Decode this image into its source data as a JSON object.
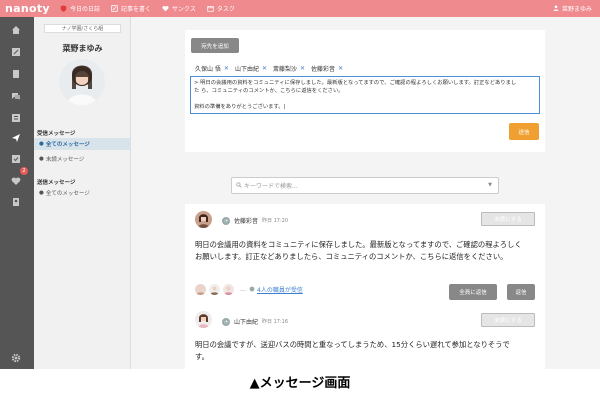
{
  "app": {
    "logo": "nanoty"
  },
  "topnav": [
    {
      "label": "今日の日誌",
      "icon": "shield-icon"
    },
    {
      "label": "記事を書く",
      "icon": "pencil-icon"
    },
    {
      "label": "サンクス",
      "icon": "heart-icon"
    },
    {
      "label": "タスク",
      "icon": "calendar-icon"
    }
  ],
  "user": {
    "name": "菜野まゆみ"
  },
  "profile": {
    "org": "ナノ学園/さくら組",
    "name": "菜野まゆみ"
  },
  "inbox": {
    "title": "受信メッセージ",
    "items": [
      "全てのメッセージ",
      "未読メッセージ"
    ]
  },
  "outbox": {
    "title": "送信メッセージ",
    "items": [
      "全てのメッセージ"
    ]
  },
  "rail": {
    "badge_count": "2"
  },
  "compose": {
    "add_recipient": "宛先を追加",
    "recipients": [
      "久保山 悟",
      "山下由紀",
      "斎藤梨沙",
      "佐藤彩音"
    ],
    "remove_glyph": "✕",
    "message_lines": [
      "> 明日の会議用の資料をコミュニティに保存しました。最新版となってますので、ご確認の程よろしくお願いします。訂正などありまし",
      "た ら、コミュニティのコメントか、こちらに返信をください。",
      "",
      "資料の準備をありがとうございます。|"
    ],
    "send_label": "送信"
  },
  "search": {
    "placeholder": "キーワードで検索..."
  },
  "messages": [
    {
      "sender": "佐藤彩音",
      "time": "昨日 17:20",
      "mark_unread": "未読にする",
      "body_lines": [
        "明日の会議用の資料をコミュニティに保存しました。最新版となってますので、ご確認の程よろしく",
        "お願いします。訂正などありましたら、コミュニティのコメントか、こちらに返信をください。"
      ],
      "readers_dots": "…",
      "readers_link": "4人の職員が受信",
      "reply_all": "全員に返信",
      "reply": "返信"
    },
    {
      "sender": "山下由紀",
      "time": "昨日 17:16",
      "mark_unread": "未読にする",
      "body_lines": [
        "明日の会議ですが、送迎バスの時間と重なってしまうため、15分くらい遅れて参加となりそうで",
        "す。"
      ]
    }
  ],
  "caption": "▲メッセージ画面",
  "colors": {
    "topbar": "#ef8a8f",
    "rail": "#555555",
    "accent": "#f0a030",
    "link": "#3f7fcf"
  }
}
